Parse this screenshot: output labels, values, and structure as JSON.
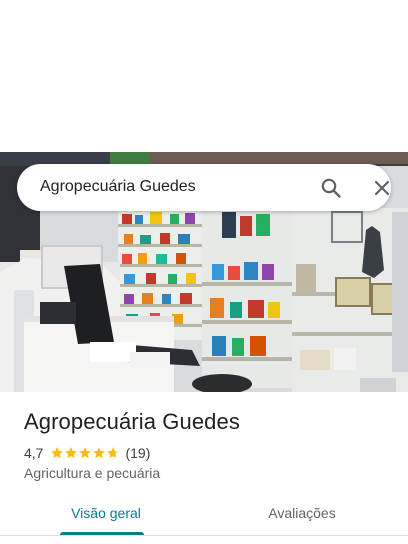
{
  "search": {
    "query": "Agropecuária Guedes"
  },
  "place": {
    "name": "Agropecuária Guedes",
    "rating": "4,7",
    "rating_stars": 4.7,
    "review_count": "(19)",
    "category": "Agricultura e pecuária"
  },
  "tabs": [
    {
      "label": "Visão geral",
      "selected": true
    },
    {
      "label": "Avaliações",
      "selected": false
    }
  ],
  "colors": {
    "accent": "#0b7b8f",
    "star": "#fbbc04"
  },
  "icons": [
    "search-icon",
    "close-icon",
    "star-icon"
  ]
}
